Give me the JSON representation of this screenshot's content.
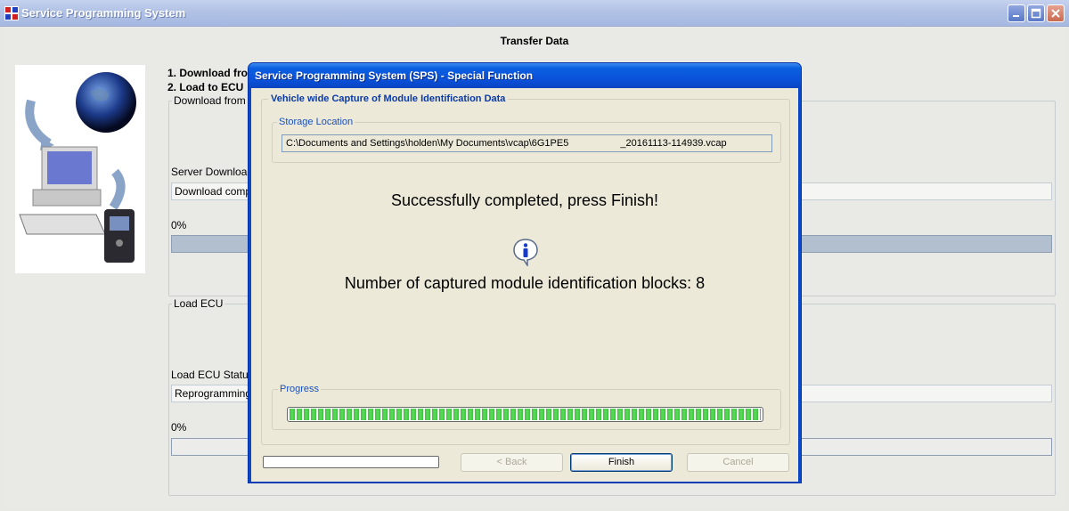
{
  "window": {
    "title": "Service Programming System"
  },
  "main": {
    "page_title": "Transfer Data",
    "steps": [
      "1. Download from",
      "2. Load to ECU"
    ],
    "download_group": {
      "legend": "Download from",
      "status_label": "Server Download",
      "status_value": "Download comp",
      "progress_text": "0%"
    },
    "load_group": {
      "legend": "Load ECU",
      "status_label": "Load ECU Statu",
      "status_value": "Reprogramming",
      "progress_text": "0%"
    }
  },
  "dialog": {
    "title": "Service Programming System (SPS) - Special Function",
    "frame_title": "Vehicle wide Capture of Module Identification Data",
    "storage": {
      "legend": "Storage Location",
      "path": "C:\\Documents and Settings\\holden\\My Documents\\vcap\\6G1PE5                   _20161113-114939.vcap"
    },
    "success_message": "Successfully completed, press Finish!",
    "count_message": "Number of captured module identification blocks: 8",
    "progress": {
      "legend": "Progress",
      "value": 1.0
    },
    "buttons": {
      "back": "< Back",
      "finish": "Finish",
      "cancel": "Cancel"
    }
  },
  "colors": {
    "dialog_title_bar": "#0a50d8",
    "progress_green": "#3ec53e",
    "frame_title_blue": "#0a3aa8"
  },
  "icons": {
    "info": "info-icon",
    "app": "app-icon",
    "minimize": "minimize-icon",
    "maximize": "maximize-icon",
    "close": "close-icon"
  }
}
